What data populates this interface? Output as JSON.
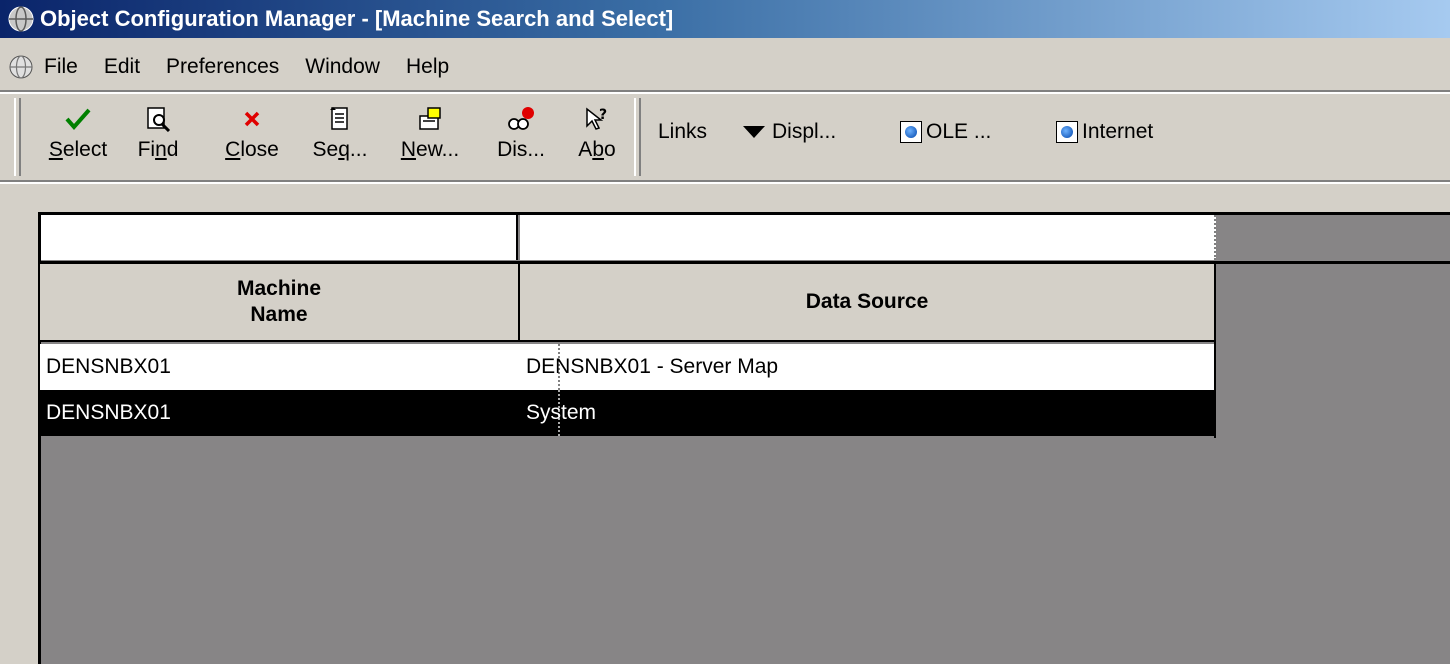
{
  "window": {
    "title": "Object Configuration Manager - [Machine Search and Select]"
  },
  "menu": {
    "items": [
      "File",
      "Edit",
      "Preferences",
      "Window",
      "Help"
    ]
  },
  "toolbar": {
    "buttons": [
      {
        "label_pre": "",
        "label_ul": "S",
        "label_post": "elect",
        "icon": "checkmark-icon"
      },
      {
        "label_pre": "Fi",
        "label_ul": "n",
        "label_post": "d",
        "icon": "find-icon"
      },
      {
        "label_pre": "",
        "label_ul": "C",
        "label_post": "lose",
        "icon": "close-x-icon"
      },
      {
        "label_pre": "Se",
        "label_ul": "q",
        "label_post": "...",
        "icon": "sequence-icon"
      },
      {
        "label_pre": "",
        "label_ul": "N",
        "label_post": "ew...",
        "icon": "new-icon"
      },
      {
        "label_pre": "Dis",
        "label_ul": "",
        "label_post": "...",
        "icon": "display-icon"
      },
      {
        "label_pre": "A",
        "label_ul": "b",
        "label_post": "o",
        "icon": "about-icon"
      }
    ],
    "links": {
      "links_label": "Links",
      "display_label": "Displ...",
      "ole_label": "OLE ...",
      "internet_label": "Internet"
    }
  },
  "grid": {
    "columns": [
      {
        "line1": "Machine",
        "line2": "Name"
      },
      {
        "line1": "Data Source",
        "line2": ""
      }
    ],
    "rows": [
      {
        "machine_name": "DENSNBX01",
        "data_source": "DENSNBX01 - Server Map",
        "selected": false
      },
      {
        "machine_name": "DENSNBX01",
        "data_source": "System",
        "selected": true
      }
    ]
  },
  "colors": {
    "title_bar_start": "#0a246a",
    "title_bar_end": "#a6caf0",
    "window_bg": "#d4d0c8",
    "grid_bg": "#878586",
    "selected_row_bg": "#000000"
  }
}
